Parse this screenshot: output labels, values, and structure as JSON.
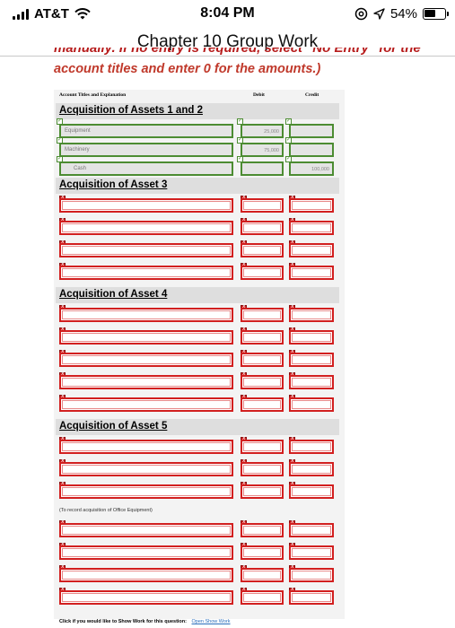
{
  "status_bar": {
    "carrier": "AT&T",
    "time": "8:04 PM",
    "battery": "54%"
  },
  "nav": {
    "title": "Chapter 10 Group Work"
  },
  "instructions": {
    "clipped": "manually. If no entry is required, select \"No Entry\" for the",
    "line": "account titles and enter 0 for the amounts.)"
  },
  "table": {
    "headers": {
      "account": "Account Titles and Explanation",
      "debit": "Debit",
      "credit": "Credit"
    }
  },
  "sections": {
    "s1": {
      "title": "Acquisition of Assets 1 and 2"
    },
    "s3": {
      "title": "Acquisition of Asset 3"
    },
    "s4": {
      "title": "Acquisition of Asset 4"
    },
    "s5": {
      "title": "Acquisition of Asset 5"
    }
  },
  "entries": {
    "r0": {
      "account": "Equipment",
      "debit": "25,000",
      "credit": ""
    },
    "r1": {
      "account": "Machinery",
      "debit": "75,000",
      "credit": ""
    },
    "r2": {
      "account": "Cash",
      "debit": "",
      "credit": "100,000"
    }
  },
  "note": "(To record acquisition of Office Equipment)",
  "footer": {
    "prompt": "Click if you would like to Show Work for this question:",
    "link": "Open Show Work"
  },
  "colors": {
    "error_border": "#d21f1f",
    "ok_border": "#4c8c32",
    "instruction_text": "#c0392b",
    "link": "#2a6ebb"
  },
  "icons": [
    "signal-icon",
    "wifi-icon",
    "at-icon",
    "location-icon",
    "battery-icon",
    "check-icon",
    "error-x-icon"
  ]
}
